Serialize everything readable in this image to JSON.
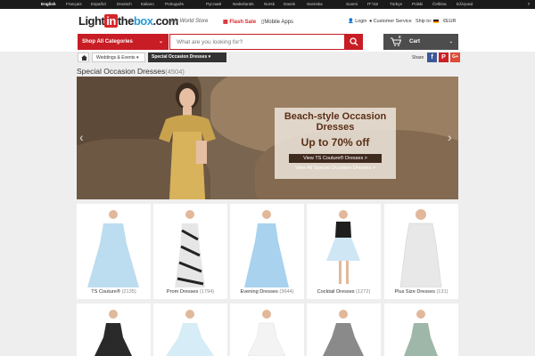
{
  "languages": {
    "active": "English",
    "items": [
      "Français",
      "Español",
      "Deutsch",
      "Italiano",
      "Português",
      "Русский",
      "Nederlands",
      "Norsk",
      "Dansk",
      "Svenska",
      "Suomi",
      "עברית",
      "Türkçe",
      "Polski",
      "Čeština",
      "Ελληνικά"
    ],
    "more_icon": "chevron-right-icon"
  },
  "header": {
    "logo_light": "Light",
    "logo_in": "in",
    "logo_the": "the",
    "logo_box": "box",
    "logo_com": ".com",
    "tagline": "My World Store",
    "flash_sale": "Flash Sale",
    "mobile_apps": "Mobile Apps",
    "login": "Login",
    "customer_service": "Customer Service",
    "ship_to": "Ship to:",
    "currency": "€EUR"
  },
  "search": {
    "categories_label": "Shop All Categories",
    "placeholder": "What are you looking for?",
    "cart_label": "Cart",
    "cart_count": "0"
  },
  "breadcrumb": {
    "items": [
      "Weddings & Events",
      "Special Occasion Dresses"
    ]
  },
  "share": {
    "label": "Share",
    "networks": [
      "f",
      "P",
      "G+"
    ]
  },
  "page": {
    "title": "Special Occasion Dresses",
    "count": "(4504)"
  },
  "banner": {
    "headline": "Beach-style Occasion Dresses",
    "discount": "Up to 70% off",
    "link1": "View TS Couture® Dresses >",
    "link2": "View All Special Occasion Dresses >",
    "slide_active": 1,
    "slide_total": 3
  },
  "categories": [
    {
      "name": "TS Couture®",
      "count": "(2135)",
      "color": "#bcdcf0"
    },
    {
      "name": "Prom Dresses",
      "count": "(1794)",
      "color": "#2a2a2a"
    },
    {
      "name": "Evening Dresses",
      "count": "(3644)",
      "color": "#a8d2ee"
    },
    {
      "name": "Cocktail Dresses",
      "count": "(1272)",
      "color": "#cfe6f5"
    },
    {
      "name": "Plus Size Dresses",
      "count": "(131)",
      "color": "#e8e8e8"
    }
  ],
  "colors": {
    "brand_red": "#c81d25",
    "cart_gray": "#4d4d4d"
  }
}
